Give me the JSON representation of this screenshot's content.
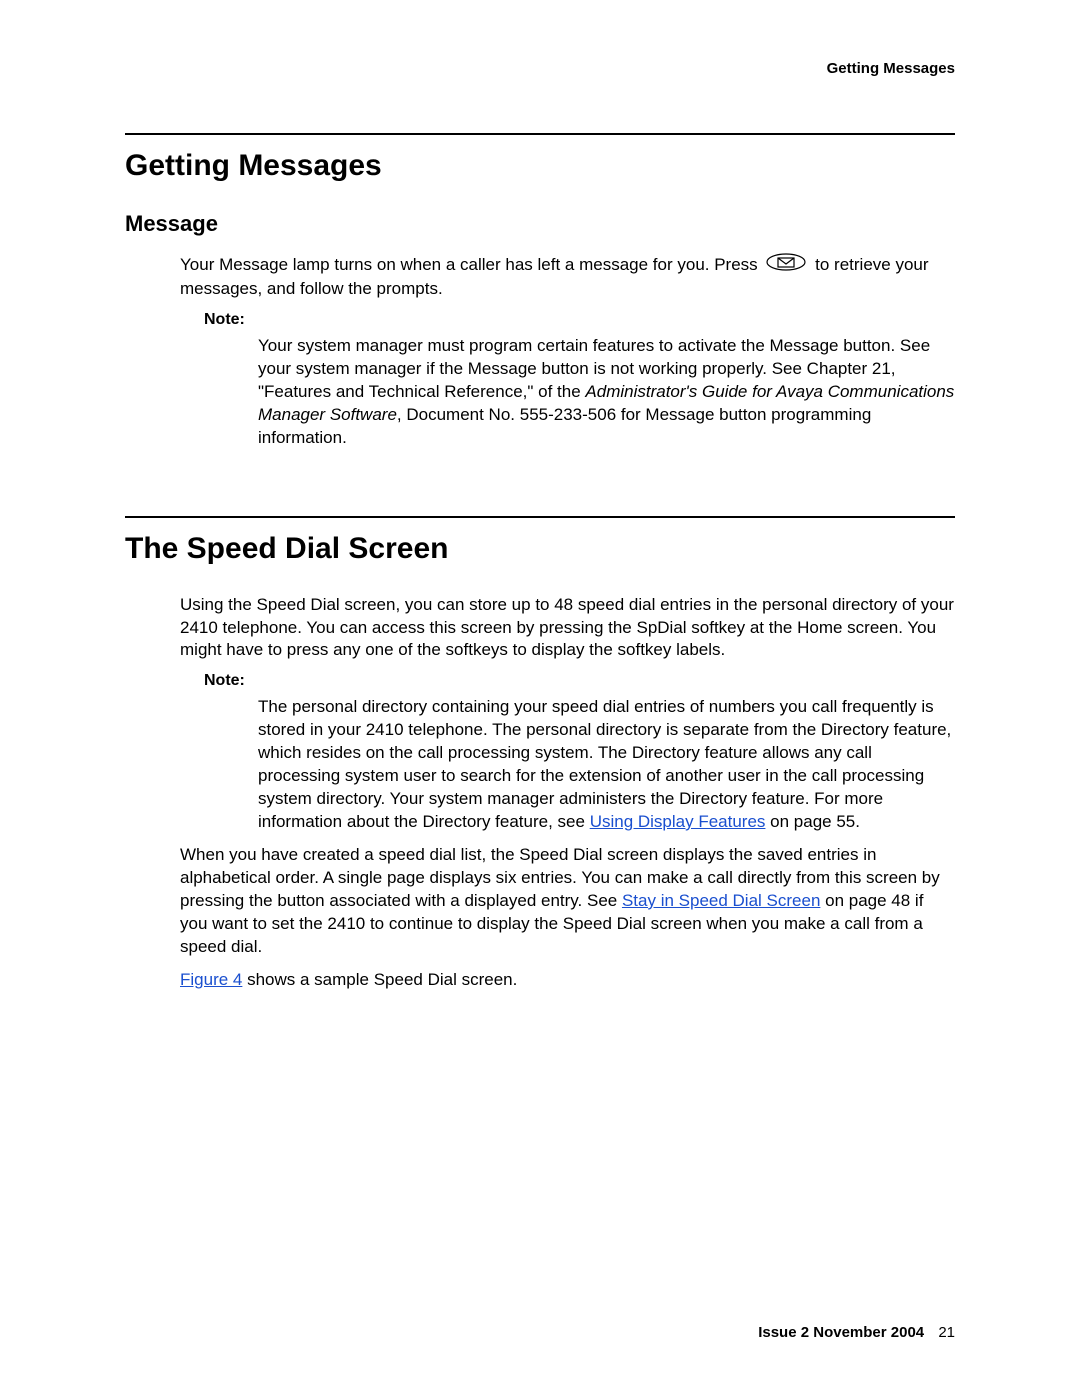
{
  "header": {
    "running_title": "Getting Messages"
  },
  "section1": {
    "heading": "Getting Messages",
    "sub_heading": "Message",
    "para1_pre": "Your Message lamp turns on when a caller has left a message for you. Press ",
    "para1_post": " to retrieve your messages, and follow the prompts.",
    "note_label": "Note:",
    "note_text_pre": "Your system manager must program certain features to activate the Message button. See your system manager if the Message button is not working properly. See Chapter 21, \"Features and Technical Reference,\" of the ",
    "note_text_italic": "Administrator's Guide for Avaya Communications Manager Software",
    "note_text_post": ", Document No. 555-233-506 for Message button programming information."
  },
  "section2": {
    "heading": "The Speed Dial Screen",
    "para1": "Using the Speed Dial screen, you can store up to 48 speed dial entries in the personal directory of your 2410 telephone. You can access this screen by pressing the SpDial softkey at the Home screen. You might have to press any one of the softkeys to display the softkey labels.",
    "note_label": "Note:",
    "note_text_pre": "The personal directory containing your speed dial entries of numbers you call frequently is stored in your 2410 telephone. The personal directory is separate from the Directory feature, which resides on the call processing system. The Directory feature allows any call processing system user to search for the extension of another user in the call processing system directory. Your system manager administers the Directory feature. For more information about the Directory feature, see ",
    "note_link1": "Using Display Features",
    "note_text_post": " on page 55.",
    "para2_pre": "When you have created a speed dial list, the Speed Dial screen displays the saved entries in alphabetical order. A single page displays six entries. You can make a call directly from this screen by pressing the button associated with a displayed entry. See ",
    "para2_link": "Stay in Speed Dial Screen",
    "para2_post": " on page 48 if you want to set the 2410 to continue to display the Speed Dial screen when you make a call from a speed dial.",
    "para3_link": "Figure 4",
    "para3_post": " shows a sample Speed Dial screen."
  },
  "footer": {
    "issue": "Issue 2   November 2004",
    "page": "21"
  },
  "icons": {
    "envelope": "envelope-icon"
  }
}
